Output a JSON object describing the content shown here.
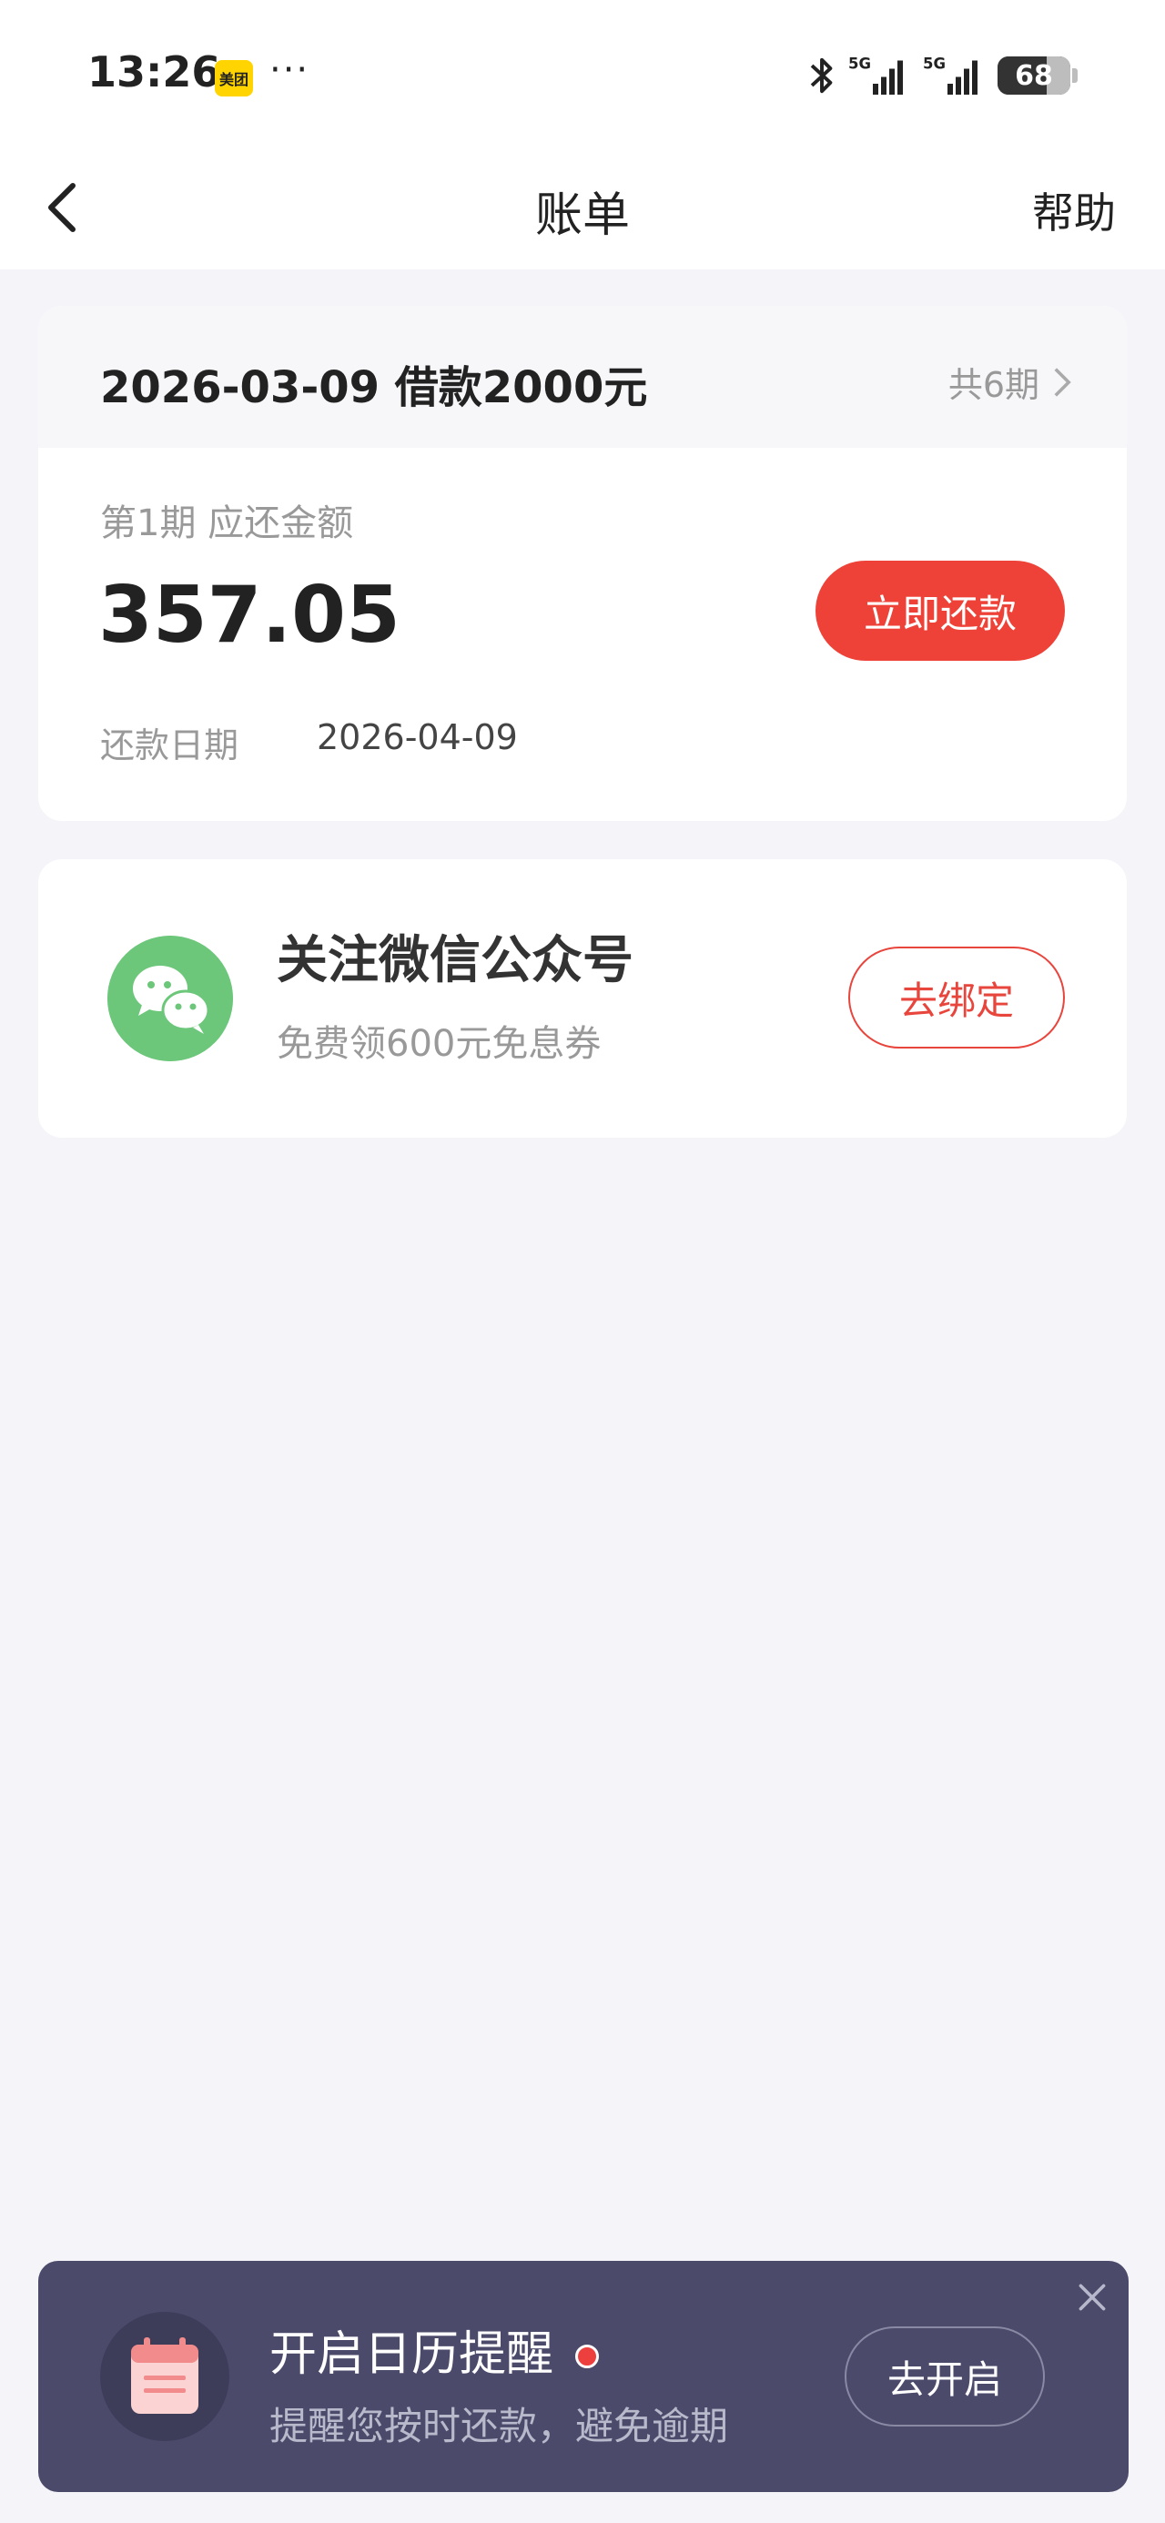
{
  "status_bar": {
    "time": "13:26",
    "app_badge": "美团",
    "more": "···",
    "battery": "68",
    "battery_level": 0.68,
    "network": "5G"
  },
  "header": {
    "title": "账单",
    "help": "帮助"
  },
  "bill": {
    "loan_title": "2026-03-09 借款2000元",
    "installments": "共6期",
    "period_label": "第1期   应还金额",
    "amount": "357.05",
    "pay_button": "立即还款",
    "due_label": "还款日期",
    "due_date": "2026-04-09"
  },
  "wechat": {
    "title": "关注微信公众号",
    "subtitle": "免费领600元免息券",
    "bind_button": "去绑定"
  },
  "calendar_banner": {
    "title": "开启日历提醒",
    "subtitle": "提醒您按时还款，避免逾期",
    "open_button": "去开启"
  },
  "colors": {
    "accent_red": "#ee4238",
    "wechat_green": "#6cc77a",
    "banner_bg": "#4b4a6b",
    "page_bg": "#f4f4f9"
  }
}
